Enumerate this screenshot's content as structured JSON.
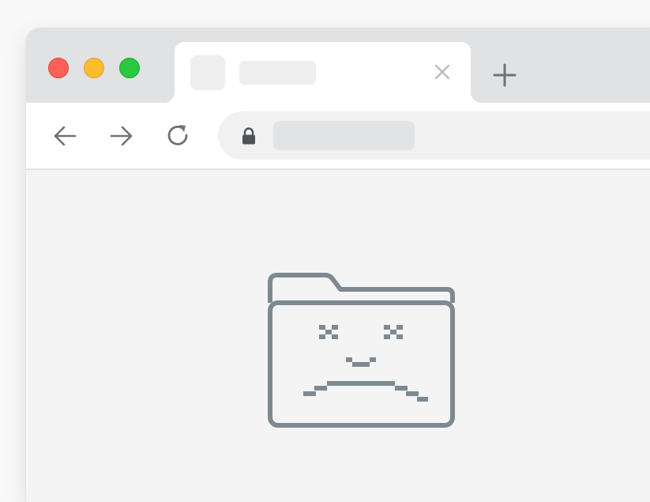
{
  "window": {
    "traffic_lights": [
      {
        "name": "close",
        "color": "#ff5f57"
      },
      {
        "name": "minimize",
        "color": "#febc2e"
      },
      {
        "name": "zoom",
        "color": "#28c840"
      }
    ]
  },
  "tab": {
    "title": "",
    "close_icon": "close-icon",
    "new_tab_icon": "plus-icon"
  },
  "toolbar": {
    "back_icon": "arrow-left-icon",
    "forward_icon": "arrow-right-icon",
    "reload_icon": "reload-icon",
    "lock_icon": "lock-icon",
    "url": ""
  },
  "content": {
    "illustration_icon": "sad-folder-icon",
    "icon_color": "#7d8a91"
  }
}
